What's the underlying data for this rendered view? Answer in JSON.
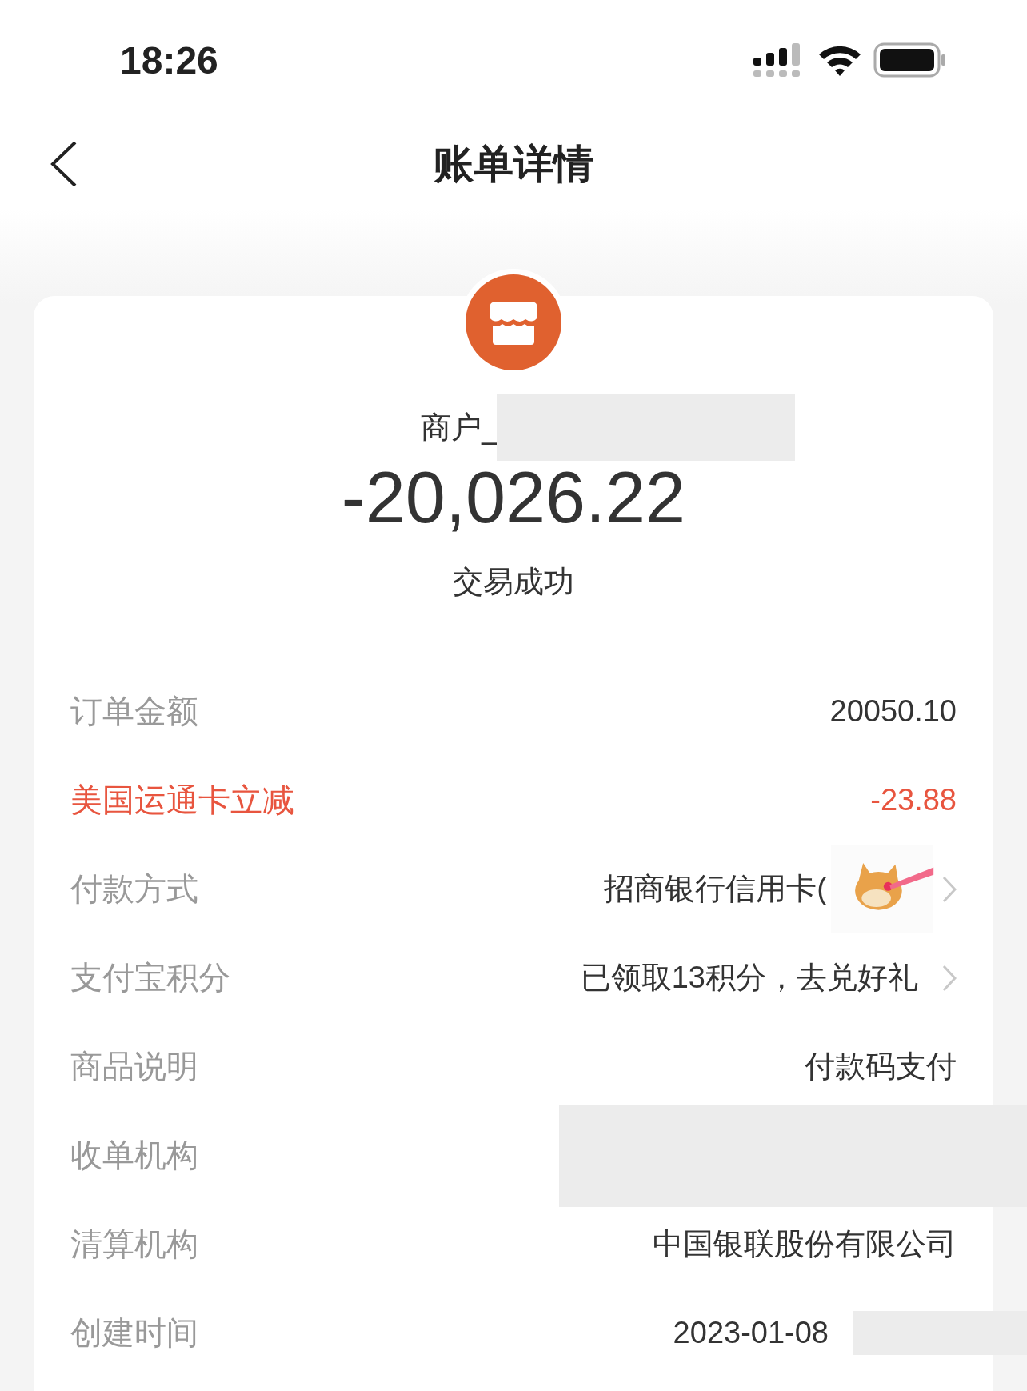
{
  "status_bar": {
    "time": "18:26"
  },
  "nav": {
    "title": "账单详情"
  },
  "merchant": {
    "name": "商户_",
    "redacted": true,
    "amount": "-20,026.22",
    "status": "交易成功"
  },
  "rows": [
    {
      "kind": "plain",
      "label": "订单金额",
      "value": "20050.10"
    },
    {
      "kind": "discount",
      "label": "美国运通卡立减",
      "value": "-23.88"
    },
    {
      "kind": "link",
      "label": "付款方式",
      "value": "招商银行信用卡(",
      "sticker": true
    },
    {
      "kind": "link",
      "label": "支付宝积分",
      "value": "已领取13积分，去兑好礼"
    },
    {
      "kind": "plain",
      "label": "商品说明",
      "value": "付款码支付"
    },
    {
      "kind": "plain",
      "label": "收单机构",
      "redacted": true
    },
    {
      "kind": "plain",
      "label": "清算机构",
      "value": "中国银联股份有限公司"
    },
    {
      "kind": "plain",
      "label": "创建时间",
      "value": "2023-01-08",
      "redacted": true
    }
  ]
}
